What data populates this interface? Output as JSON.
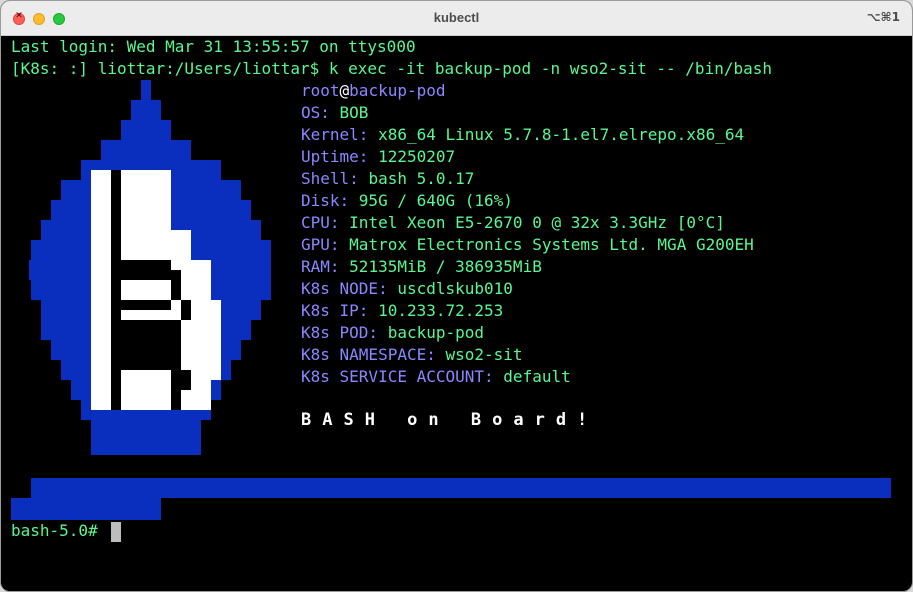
{
  "window": {
    "title": "kubectl",
    "shortcut": "⌥⌘1"
  },
  "terminal": {
    "last_login": "Last login: Wed Mar 31 13:55:57 on ttys000",
    "command_line": "[K8s: :] liottar:/Users/liottar$ k exec -it backup-pod -n wso2-sit -- /bin/bash",
    "user": "root",
    "at": "@",
    "host": "backup-pod",
    "info": [
      {
        "key": "OS: ",
        "value": "BOB"
      },
      {
        "key": "Kernel: ",
        "value": "x86_64 Linux 5.7.8-1.el7.elrepo.x86_64"
      },
      {
        "key": "Uptime: ",
        "value": "12250207"
      },
      {
        "key": "Shell: ",
        "value": "bash 5.0.17"
      },
      {
        "key": "Disk: ",
        "value": "95G / 640G (16%)"
      },
      {
        "key": "CPU: ",
        "value": "Intel Xeon E5-2670 0 @ 32x 3.3GHz [0°C]"
      },
      {
        "key": "GPU: ",
        "value": "Matrox Electronics Systems Ltd. MGA G200EH"
      },
      {
        "key": "RAM: ",
        "value": "52135MiB / 386935MiB"
      },
      {
        "key": "K8s NODE: ",
        "value": "uscdlskub010"
      },
      {
        "key": "K8s IP: ",
        "value": "10.233.72.253"
      },
      {
        "key": "K8s POD: ",
        "value": "backup-pod"
      },
      {
        "key": "K8s NAMESPACE: ",
        "value": "wso2-sit"
      },
      {
        "key": "K8s SERVICE ACCOUNT: ",
        "value": "default"
      }
    ],
    "banner": "BASH on Board!",
    "prompt": "bash-5.0# "
  },
  "colors": {
    "background": "#000000",
    "green_text": "#5af78e",
    "key_text": "#8a87ff",
    "logo_blue": "#0a2fbf",
    "logo_white": "#ffffff"
  },
  "icons": [
    "close-icon",
    "minimize-icon",
    "zoom-icon",
    "bash-logo-icon"
  ]
}
